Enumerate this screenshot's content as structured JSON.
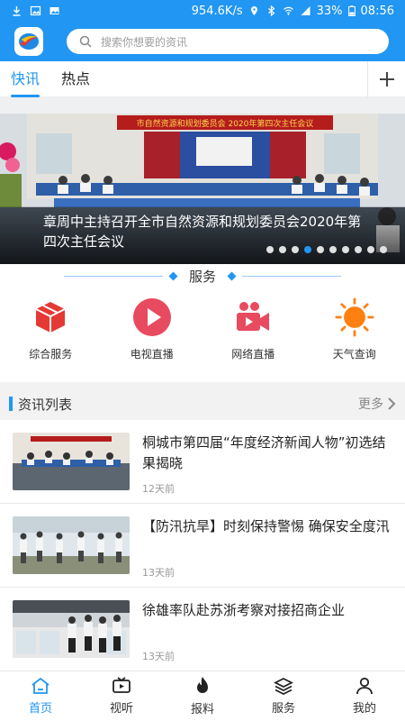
{
  "status_bar": {
    "speed": "954.6K/s",
    "battery": "33%",
    "time": "08:56"
  },
  "header": {
    "search_placeholder": "搜索你想要的资讯"
  },
  "tabs": [
    {
      "label": "快讯",
      "active": true
    },
    {
      "label": "热点",
      "active": false
    }
  ],
  "banner": {
    "sign_text": "市自然资源和规划委员会 2020年第四次主任会议",
    "caption": "章周中主持召开全市自然资源和规划委员会2020年第四次主任会议",
    "dot_count": 10,
    "active_dot": 3
  },
  "services": {
    "title": "服务",
    "items": [
      {
        "label": "综合服务",
        "icon": "cube-icon",
        "color": "#e53935"
      },
      {
        "label": "电视直播",
        "icon": "play-icon",
        "color": "#e84a5f"
      },
      {
        "label": "网络直播",
        "icon": "video-camera-icon",
        "color": "#e84a5f"
      },
      {
        "label": "天气查询",
        "icon": "sun-icon",
        "color": "#ff7f11"
      }
    ]
  },
  "news": {
    "title": "资讯列表",
    "more": "更多",
    "items": [
      {
        "title": "桐城市第四届“年度经济新闻人物”初选结果揭晓",
        "time": "12天前"
      },
      {
        "title": "【防汛抗旱】时刻保持警惕 确保安全度汛",
        "time": "13天前"
      },
      {
        "title": "徐雄率队赴苏浙考察对接招商企业",
        "time": "13天前"
      }
    ]
  },
  "bottom_nav": [
    {
      "label": "首页",
      "icon": "home-icon",
      "active": true
    },
    {
      "label": "视听",
      "icon": "tv-icon",
      "active": false
    },
    {
      "label": "报料",
      "icon": "flame-icon",
      "active": false
    },
    {
      "label": "服务",
      "icon": "layers-icon",
      "active": false
    },
    {
      "label": "我的",
      "icon": "user-icon",
      "active": false
    }
  ],
  "colors": {
    "primary": "#2196f3",
    "red": "#e53935",
    "orange": "#ff7f11"
  }
}
